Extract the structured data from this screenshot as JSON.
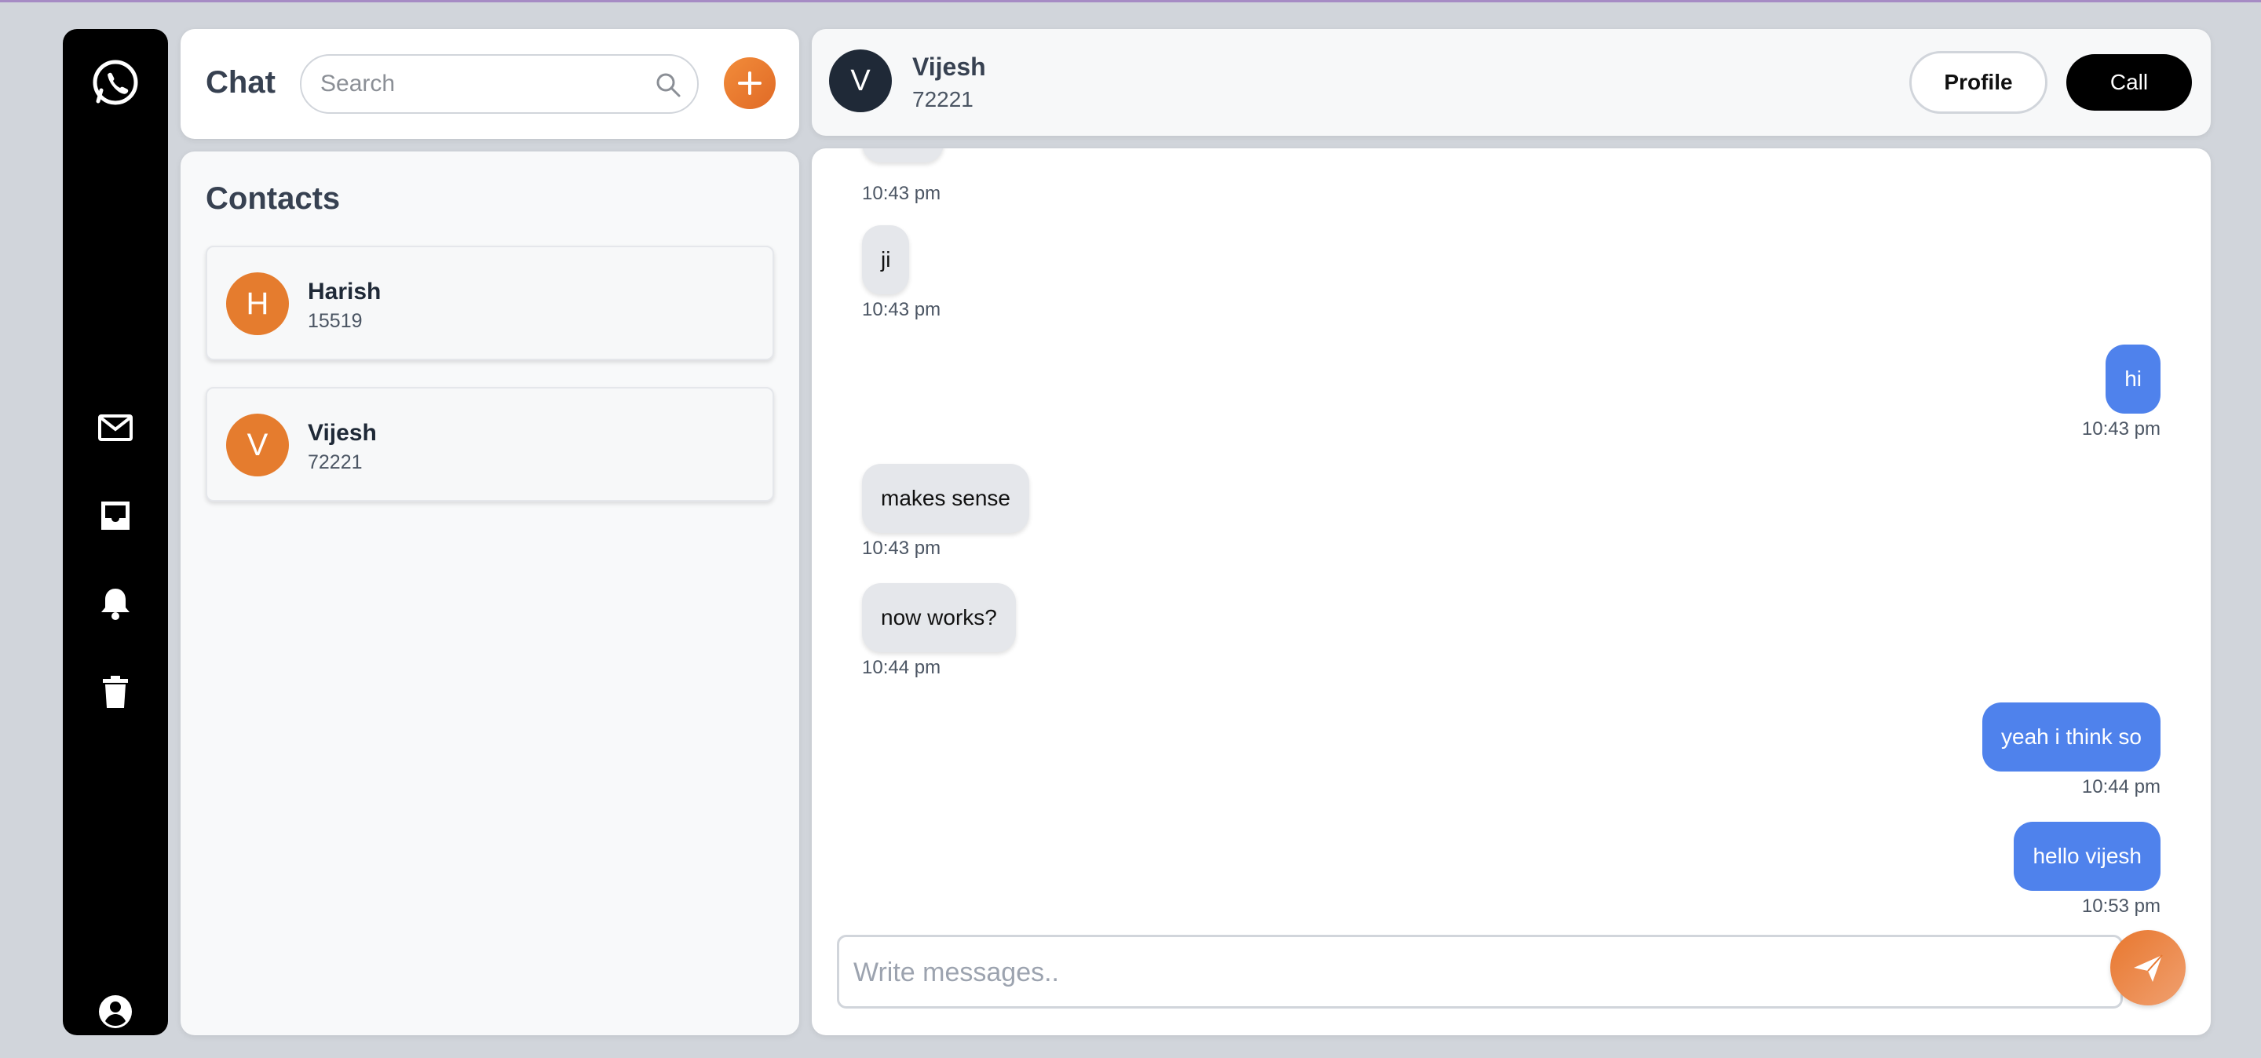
{
  "colors": {
    "accent": "#e57c2e",
    "outgoing_bubble": "#4f82ec",
    "rail": "#000000"
  },
  "rail": {
    "icons": [
      "whatsapp-icon",
      "mail-icon",
      "inbox-icon",
      "bell-icon",
      "trash-icon",
      "user-circle-icon"
    ]
  },
  "sidebar": {
    "title": "Chat",
    "search": {
      "placeholder": "Search",
      "value": ""
    },
    "contacts_title": "Contacts",
    "contacts": [
      {
        "initial": "H",
        "name": "Harish",
        "number": "15519"
      },
      {
        "initial": "V",
        "name": "Vijesh",
        "number": "72221"
      }
    ]
  },
  "conversation": {
    "initial": "V",
    "name": "Vijesh",
    "number": "72221",
    "profile_label": "Profile",
    "call_label": "Call",
    "top_time": "10:43 pm",
    "messages": [
      {
        "dir": "in",
        "text": "ji",
        "time": "10:43 pm"
      },
      {
        "dir": "out",
        "text": "hi",
        "time": "10:43 pm"
      },
      {
        "dir": "in",
        "text": "makes sense",
        "time": "10:43 pm"
      },
      {
        "dir": "in",
        "text": "now works?",
        "time": "10:44 pm"
      },
      {
        "dir": "out",
        "text": "yeah i think so",
        "time": "10:44 pm"
      },
      {
        "dir": "out",
        "text": "hello vijesh",
        "time": "10:53 pm"
      }
    ],
    "compose_placeholder": "Write messages.."
  }
}
